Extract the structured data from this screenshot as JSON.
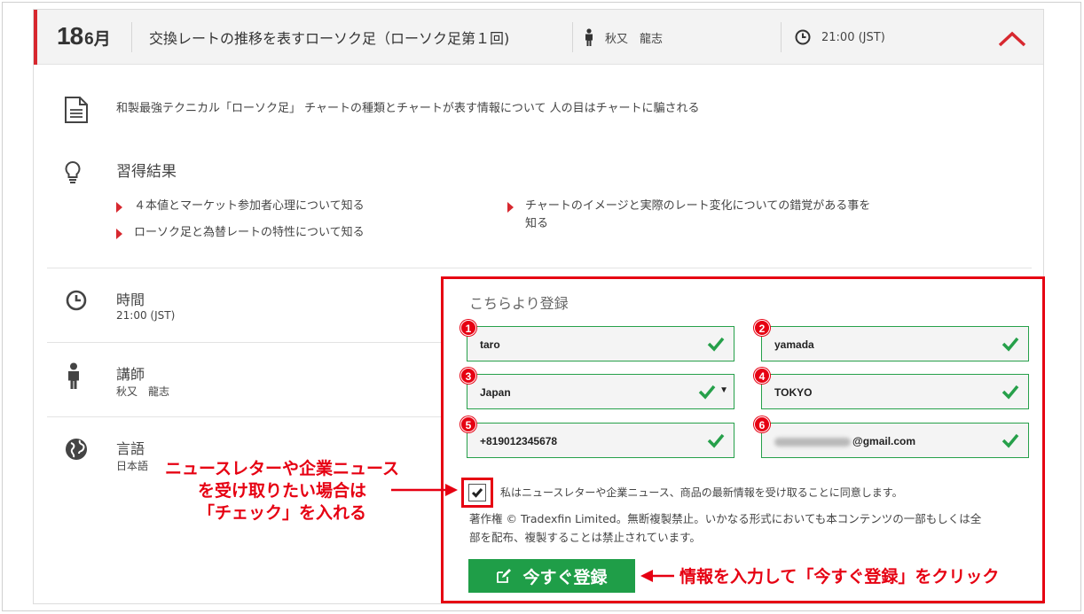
{
  "header": {
    "day": "18",
    "month": "6月",
    "title": "交換レートの推移を表すローソク足（ローソク足第１回)",
    "instructor": "秋又　龍志",
    "time": "21:00 (JST)"
  },
  "description": "和製最強テクニカル「ローソク足」 チャートの種類とチャートが表す情報について 人の目はチャートに騙される",
  "learning": {
    "title": "習得結果",
    "items": [
      "４本値とマーケット参加者心理について知る",
      "ローソク足と為替レートの特性について知る",
      "チャートのイメージと実際のレート変化についての錯覚がある事を",
      "知る"
    ]
  },
  "info": {
    "time_title": "時間",
    "time_value": "21:00 (JST)",
    "instructor_title": "講師",
    "instructor_value": "秋又　龍志",
    "language_title": "言語",
    "language_value": "日本語"
  },
  "registration": {
    "title": "こちらより登録",
    "fields": [
      {
        "badge": "1",
        "value": "taro"
      },
      {
        "badge": "2",
        "value": "yamada"
      },
      {
        "badge": "3",
        "value": "Japan"
      },
      {
        "badge": "4",
        "value": "TOKYO"
      },
      {
        "badge": "5",
        "value": "+819012345678"
      },
      {
        "badge": "6",
        "value": "@gmail.com"
      }
    ],
    "agree_text": "私はニュースレターや企業ニュース、商品の最新情報を受け取ることに同意します。",
    "copyright_line1": "著作権 © Tradexfin Limited。無断複製禁止。いかなる形式においても本コンテンツの一部もしくは全",
    "copyright_line2": "部を配布、複製することは禁止されています。",
    "submit_label": "今すぐ登録"
  },
  "annotations": {
    "left_line1": "ニュースレターや企業ニュース",
    "left_line2": "を受け取りたい場合は",
    "left_line3": "「チェック」を入れる",
    "right": "情報を入力して「今すぐ登録」をクリック"
  },
  "colors": {
    "accent_red": "#d7282f",
    "annotation_red": "#e60012",
    "success_green": "#26a04a",
    "button_green": "#1f9e48"
  }
}
